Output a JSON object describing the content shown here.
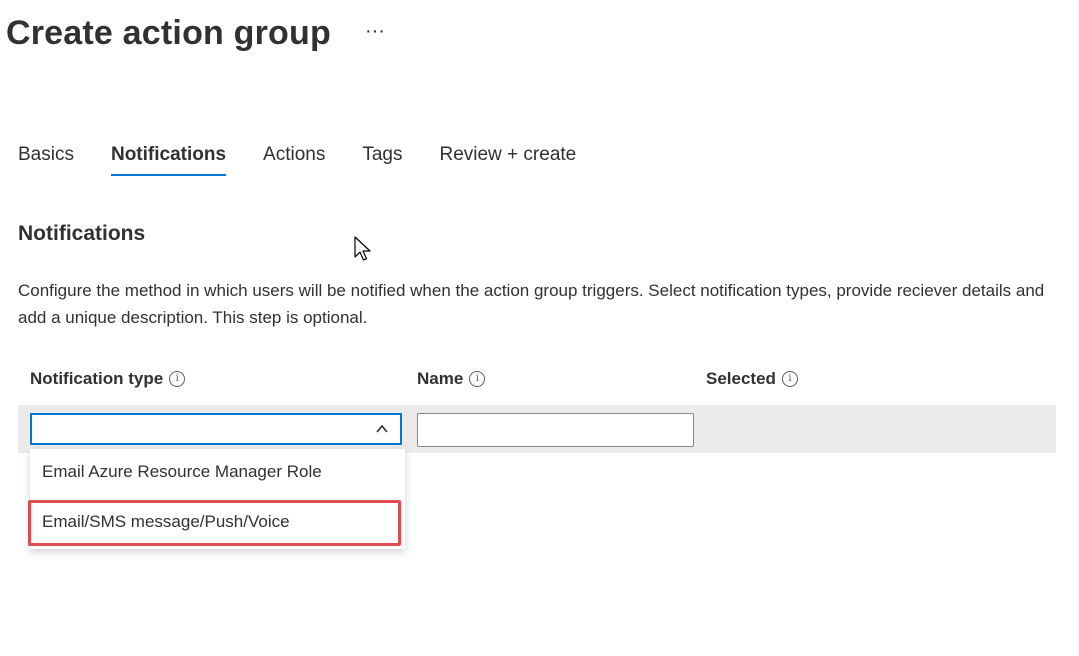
{
  "header": {
    "title": "Create action group",
    "more_label": "···"
  },
  "tabs": [
    {
      "label": "Basics",
      "active": false
    },
    {
      "label": "Notifications",
      "active": true
    },
    {
      "label": "Actions",
      "active": false
    },
    {
      "label": "Tags",
      "active": false
    },
    {
      "label": "Review + create",
      "active": false
    }
  ],
  "section": {
    "title": "Notifications",
    "description": "Configure the method in which users will be notified when the action group triggers. Select notification types, provide reciever details and add a unique description. This step is optional."
  },
  "table": {
    "columns": [
      {
        "label": "Notification type",
        "info_icon": "info-icon"
      },
      {
        "label": "Name",
        "info_icon": "info-icon"
      },
      {
        "label": "Selected",
        "info_icon": "info-icon"
      }
    ],
    "row": {
      "notification_type_value": "",
      "name_value": "",
      "name_placeholder": ""
    }
  },
  "dropdown": {
    "expanded": true,
    "options": [
      {
        "label": "Email Azure Resource Manager Role",
        "highlighted": false
      },
      {
        "label": "Email/SMS message/Push/Voice",
        "highlighted": true
      }
    ]
  },
  "colors": {
    "accent": "#0078d4",
    "highlight_border": "#e04c54",
    "row_band": "#edebe9"
  },
  "icons": {
    "more": "ellipsis-icon",
    "select_toggle": "chevron-up-icon",
    "info": "info-icon",
    "cursor": "mouse-pointer-icon"
  }
}
